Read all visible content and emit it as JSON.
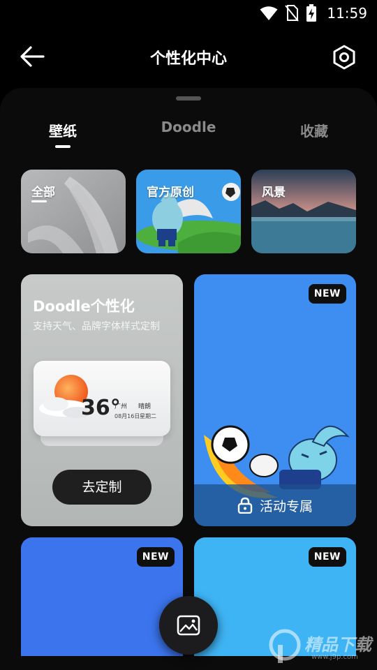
{
  "status_bar": {
    "time": "11:59",
    "icons": [
      "wifi-icon",
      "no-sim-icon",
      "battery-charging-icon"
    ]
  },
  "header": {
    "title": "个性化中心",
    "back_icon": "arrow-left-icon",
    "settings_icon": "hexagon-settings-icon"
  },
  "tabs": [
    {
      "label": "壁纸",
      "active": true
    },
    {
      "label": "Doodle",
      "active": false
    },
    {
      "label": "收藏",
      "active": false
    }
  ],
  "categories": [
    {
      "label": "全部",
      "selected": true
    },
    {
      "label": "官方原创",
      "selected": false
    },
    {
      "label": "风景",
      "selected": false
    }
  ],
  "doodle_card": {
    "title": "Doodle个性化",
    "description": "支持天气、品牌字体样式定制",
    "widget": {
      "temperature": "36°",
      "city": "广州",
      "condition": "晴朗",
      "date": "08月16日",
      "weekday": "星期二"
    },
    "button_label": "去定制"
  },
  "event_card": {
    "badge": "NEW",
    "lock_label": "活动专属",
    "lock_icon": "lock-icon"
  },
  "bottom_cards": [
    {
      "badge": "NEW",
      "color": "#3b74ec"
    },
    {
      "badge": "NEW",
      "color": "#3fb4f5"
    }
  ],
  "fab": {
    "icon": "image-icon"
  },
  "watermark": {
    "text": "精品下载",
    "url": "www.j9p.com"
  },
  "colors": {
    "background": "#000000",
    "sheet": "#0b0b0c",
    "event_blue": "#3d8ef0"
  }
}
